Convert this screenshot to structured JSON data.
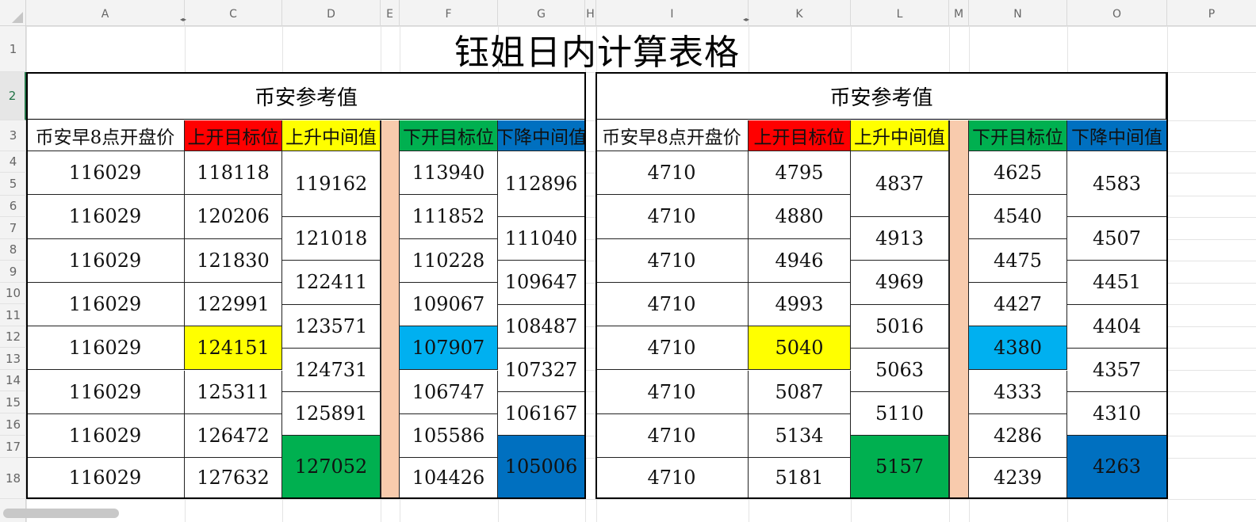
{
  "sheet": {
    "columns": [
      "A",
      "C",
      "D",
      "E",
      "F",
      "G",
      "H",
      "I",
      "K",
      "L",
      "M",
      "N",
      "O",
      "P"
    ],
    "rows": [
      "1",
      "2",
      "3",
      "4",
      "5",
      "6",
      "7",
      "8",
      "9",
      "10",
      "11",
      "12",
      "13",
      "14",
      "15",
      "16",
      "17",
      "18"
    ],
    "title": "钰姐日内计算表格"
  },
  "left_table": {
    "header": "币安参考值",
    "col_labels": [
      "币安早8点开盘价",
      "上开目标位",
      "上升中间值",
      "下开目标位",
      "下降中间值"
    ],
    "open": [
      "116029",
      "116029",
      "116029",
      "116029",
      "116029",
      "116029",
      "116029",
      "116029"
    ],
    "up_target": [
      "118118",
      "120206",
      "121830",
      "122991",
      "124151",
      "125311",
      "126472",
      "127632"
    ],
    "up_mid": [
      "119162",
      "121018",
      "122411",
      "123571",
      "124731",
      "125891",
      "127052"
    ],
    "down_target": [
      "113940",
      "111852",
      "110228",
      "109067",
      "107907",
      "106747",
      "105586",
      "104426"
    ],
    "down_mid": [
      "112896",
      "111040",
      "109647",
      "108487",
      "107327",
      "106167",
      "105006"
    ]
  },
  "right_table": {
    "header": "币安参考值",
    "col_labels": [
      "币安早8点开盘价",
      "上开目标位",
      "上升中间值",
      "下开目标位",
      "下降中间值"
    ],
    "open": [
      "4710",
      "4710",
      "4710",
      "4710",
      "4710",
      "4710",
      "4710",
      "4710"
    ],
    "up_target": [
      "4795",
      "4880",
      "4946",
      "4993",
      "5040",
      "5087",
      "5134",
      "5181"
    ],
    "up_mid": [
      "4837",
      "4913",
      "4969",
      "5016",
      "5063",
      "5110",
      "5157"
    ],
    "down_target": [
      "4625",
      "4540",
      "4475",
      "4427",
      "4380",
      "4333",
      "4286",
      "4239"
    ],
    "down_mid": [
      "4583",
      "4507",
      "4451",
      "4404",
      "4357",
      "4310",
      "4263"
    ]
  },
  "colors": {
    "up_label": "#ff0000",
    "up_mid_label": "#ffff00",
    "down_label": "#00b050",
    "down_mid_label": "#0070c0",
    "highlight_up": "#ffff00",
    "highlight_down": "#00b0f0",
    "separator": "#f8cbad",
    "up_mid_last": "#00b050",
    "down_mid_last": "#0070c0"
  }
}
